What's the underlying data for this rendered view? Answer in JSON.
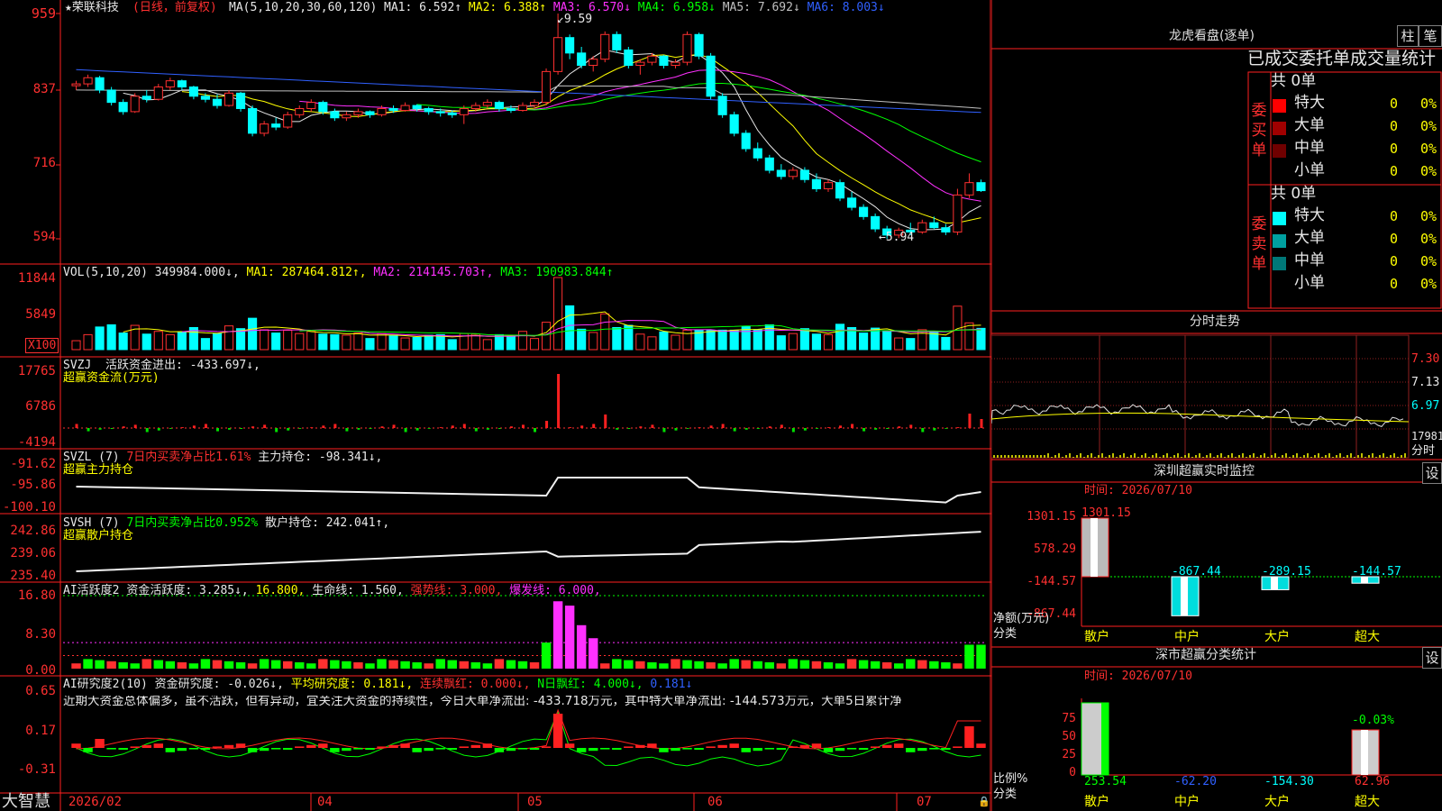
{
  "main": {
    "stock_name": "★荣联科技",
    "period": "(日线，前复权)",
    "ma_label": "MA(5,10,20,30,60,120)",
    "ma": [
      {
        "label": "MA1: 6.592↑",
        "color": "#e8e8e8"
      },
      {
        "label": "MA2: 6.388↑",
        "color": "#ffff00"
      },
      {
        "label": "MA3: 6.570↓",
        "color": "#ff30ff"
      },
      {
        "label": "MA4: 6.958↓",
        "color": "#00ff00"
      },
      {
        "label": "MA5: 7.692↓",
        "color": "#c0c0c0"
      },
      {
        "label": "MA6: 8.003↓",
        "color": "#3060ff"
      }
    ],
    "high_marker": "9.59",
    "low_marker": "5.94",
    "y_ticks": [
      "959",
      "837",
      "716",
      "594"
    ],
    "candles": [
      [
        8.42,
        8.5,
        8.35,
        8.45
      ],
      [
        8.45,
        8.6,
        8.4,
        8.55
      ],
      [
        8.55,
        8.58,
        8.3,
        8.35
      ],
      [
        8.35,
        8.4,
        8.1,
        8.15
      ],
      [
        8.15,
        8.2,
        7.95,
        8.0
      ],
      [
        8.0,
        8.3,
        7.98,
        8.25
      ],
      [
        8.25,
        8.35,
        8.15,
        8.2
      ],
      [
        8.2,
        8.45,
        8.18,
        8.4
      ],
      [
        8.4,
        8.55,
        8.35,
        8.5
      ],
      [
        8.5,
        8.52,
        8.35,
        8.4
      ],
      [
        8.4,
        8.42,
        8.2,
        8.25
      ],
      [
        8.25,
        8.3,
        8.15,
        8.2
      ],
      [
        8.2,
        8.28,
        8.05,
        8.1
      ],
      [
        8.1,
        8.35,
        8.08,
        8.3
      ],
      [
        8.3,
        8.32,
        8.0,
        8.05
      ],
      [
        8.05,
        8.1,
        7.6,
        7.65
      ],
      [
        7.65,
        7.85,
        7.6,
        7.8
      ],
      [
        7.8,
        7.9,
        7.7,
        7.75
      ],
      [
        7.75,
        8.0,
        7.72,
        7.95
      ],
      [
        7.95,
        8.1,
        7.9,
        8.05
      ],
      [
        8.05,
        8.2,
        8.0,
        8.15
      ],
      [
        8.15,
        8.18,
        7.95,
        8.0
      ],
      [
        8.0,
        8.05,
        7.85,
        7.9
      ],
      [
        7.9,
        8.0,
        7.85,
        7.95
      ],
      [
        7.95,
        8.05,
        7.9,
        8.0
      ],
      [
        8.0,
        8.02,
        7.9,
        7.95
      ],
      [
        7.95,
        8.1,
        7.92,
        8.05
      ],
      [
        8.05,
        8.1,
        7.98,
        8.02
      ],
      [
        8.02,
        8.15,
        8.0,
        8.1
      ],
      [
        8.1,
        8.12,
        8.0,
        8.05
      ],
      [
        8.05,
        8.08,
        7.95,
        8.0
      ],
      [
        8.0,
        8.05,
        7.92,
        7.98
      ],
      [
        7.98,
        8.02,
        7.9,
        7.95
      ],
      [
        7.95,
        8.1,
        7.8,
        8.05
      ],
      [
        8.05,
        8.15,
        8.0,
        8.1
      ],
      [
        8.1,
        8.2,
        8.05,
        8.15
      ],
      [
        8.15,
        8.18,
        8.0,
        8.05
      ],
      [
        8.05,
        8.1,
        7.98,
        8.02
      ],
      [
        8.02,
        8.15,
        8.0,
        8.1
      ],
      [
        8.1,
        8.2,
        8.05,
        8.15
      ],
      [
        8.15,
        8.7,
        8.1,
        8.65
      ],
      [
        8.65,
        9.59,
        8.6,
        9.2
      ],
      [
        9.2,
        9.25,
        8.85,
        8.95
      ],
      [
        8.95,
        9.05,
        8.7,
        8.75
      ],
      [
        8.75,
        8.9,
        8.65,
        8.85
      ],
      [
        8.85,
        9.3,
        8.8,
        9.25
      ],
      [
        9.25,
        9.3,
        8.95,
        9.0
      ],
      [
        9.0,
        9.05,
        8.7,
        8.75
      ],
      [
        8.75,
        8.85,
        8.6,
        8.8
      ],
      [
        8.8,
        8.95,
        8.75,
        8.9
      ],
      [
        8.9,
        8.92,
        8.7,
        8.75
      ],
      [
        8.75,
        8.85,
        8.7,
        8.8
      ],
      [
        8.8,
        9.3,
        8.75,
        9.25
      ],
      [
        9.25,
        9.28,
        8.85,
        8.9
      ],
      [
        8.9,
        8.95,
        8.2,
        8.25
      ],
      [
        8.25,
        8.3,
        7.9,
        7.95
      ],
      [
        7.95,
        8.0,
        7.6,
        7.65
      ],
      [
        7.65,
        7.7,
        7.35,
        7.4
      ],
      [
        7.4,
        7.5,
        7.2,
        7.25
      ],
      [
        7.25,
        7.3,
        7.0,
        7.05
      ],
      [
        7.05,
        7.15,
        6.9,
        6.95
      ],
      [
        6.95,
        7.1,
        6.9,
        7.05
      ],
      [
        7.05,
        7.1,
        6.85,
        6.9
      ],
      [
        6.9,
        7.0,
        6.7,
        6.75
      ],
      [
        6.75,
        6.9,
        6.7,
        6.85
      ],
      [
        6.85,
        6.9,
        6.55,
        6.6
      ],
      [
        6.6,
        6.7,
        6.4,
        6.45
      ],
      [
        6.45,
        6.5,
        6.25,
        6.3
      ],
      [
        6.3,
        6.35,
        6.05,
        6.1
      ],
      [
        6.1,
        6.15,
        5.94,
        6.0
      ],
      [
        6.0,
        6.12,
        5.95,
        6.08
      ],
      [
        6.08,
        6.2,
        6.0,
        6.05
      ],
      [
        6.05,
        6.25,
        6.02,
        6.2
      ],
      [
        6.2,
        6.3,
        6.1,
        6.12
      ],
      [
        6.12,
        6.18,
        6.0,
        6.05
      ],
      [
        6.05,
        6.75,
        6.0,
        6.65
      ],
      [
        6.65,
        7.0,
        6.6,
        6.85
      ],
      [
        6.85,
        6.9,
        6.7,
        6.72
      ]
    ]
  },
  "vol": {
    "label": "VOL(5,10,20)",
    "value": "349984.000↓,",
    "ma1": "MA1: 287464.812↑,",
    "ma2": "MA2: 214145.703↑,",
    "ma3": "MA3: 190983.844↑",
    "y_ticks": [
      "11844",
      "5849"
    ],
    "unit": "X100"
  },
  "svzj": {
    "title": "SVZJ",
    "desc": "活跃资金进出: -433.697↓,",
    "sub": "超赢资金流(万元)",
    "y_ticks": [
      "17765",
      "6786",
      "-4194"
    ]
  },
  "svzl": {
    "title": "SVZL (7)",
    "pct": "7日内买卖净占比1.61%",
    "desc": "主力持仓: -98.341↓,",
    "sub": "超赢主力持仓",
    "y_ticks": [
      "-91.62",
      "-95.86",
      "-100.10"
    ]
  },
  "svsh": {
    "title": "SVSH (7)",
    "pct": "7日内买卖净占比0.952%",
    "desc": "散户持仓: 242.041↑,",
    "sub": "超赢散户持仓",
    "y_ticks": [
      "242.86",
      "239.06",
      "235.40"
    ]
  },
  "ai1": {
    "title": "AI活跃度2",
    "a": "资金活跃度: 3.285↓,",
    "b": "16.800,",
    "c": "生命线: 1.560,",
    "d": "强势线: 3.000,",
    "e": "爆发线: 6.000,",
    "y_ticks": [
      "16.80",
      "8.30",
      "0.00"
    ]
  },
  "ai2": {
    "title": "AI研究度2(10)",
    "a": "资金研究度: -0.026↓,",
    "b": "平均研究度: 0.181↓,",
    "c": "连续飘红: 0.000↓,",
    "d": "N日飘红: 4.000↓,",
    "e": "0.181↓",
    "comment": "近期大资金总体偏多，虽不活跃，但有异动，宜关注大资金的持续性，今日大单净流出: -433.718万元，其中特大单净流出: -144.573万元，大单5日累计净",
    "y_ticks": [
      "0.65",
      "0.17",
      "-0.31"
    ]
  },
  "xaxis": [
    "2026/02",
    "04",
    "05",
    "06",
    "07"
  ],
  "brand": "大智慧",
  "right": {
    "lhb_title": "龙虎看盘(逐单)",
    "btn_zhu": "柱",
    "btn_bi": "笔",
    "tabs": "已成交委托单成交量统计",
    "buy_side": "委买单",
    "sell_side": "委卖单",
    "buy_total": "共 0单",
    "sell_total": "共 0单",
    "buy_rows": [
      {
        "label": "特大",
        "color": "#ff0000",
        "n": "0",
        "p": "0%"
      },
      {
        "label": "大单",
        "color": "#a00000",
        "n": "0",
        "p": "0%"
      },
      {
        "label": "中单",
        "color": "#700000",
        "n": "0",
        "p": "0%"
      },
      {
        "label": "小单",
        "color": "",
        "n": "0",
        "p": "0%"
      }
    ],
    "sell_rows": [
      {
        "label": "特大",
        "color": "#00ffff",
        "n": "0",
        "p": "0%"
      },
      {
        "label": "大单",
        "color": "#00a0a0",
        "n": "0",
        "p": "0%"
      },
      {
        "label": "中单",
        "color": "#007878",
        "n": "0",
        "p": "0%"
      },
      {
        "label": "小单",
        "color": "",
        "n": "0",
        "p": "0%"
      }
    ],
    "fs_title": "分时走势",
    "fs_ticks": [
      "7.30",
      "7.13",
      "6.97",
      "17981",
      "分时"
    ],
    "sz_title": "深圳超赢实时监控",
    "sz_time": "时间: 2026/07/10",
    "sz_ticks": [
      "1301.15",
      "578.29",
      "-144.57",
      "-867.44"
    ],
    "sz_ylabel": "净额(万元)",
    "sz_xlabel": "分类",
    "sz_cats": [
      "散户",
      "中户",
      "大户",
      "超大"
    ],
    "sz_values": [
      1301.15,
      -867.44,
      -289.15,
      -144.57
    ],
    "sz_labels": [
      "1301.15",
      "-867.44",
      "-289.15",
      "-144.57"
    ],
    "sh_title": "深市超赢分类统计",
    "sh_time": "时间: 2026/07/10",
    "sh_ticks": [
      "75",
      "50",
      "25",
      "0"
    ],
    "sh_ylabel": "比例%",
    "sh_xlabel": "分类",
    "sh_cats": [
      "散户",
      "中户",
      "大户",
      "超大"
    ],
    "sh_bottom": [
      "253.54",
      "-62.20",
      "-154.30",
      "62.96"
    ],
    "sh_top": "-0.03%",
    "btn_set": "设"
  }
}
